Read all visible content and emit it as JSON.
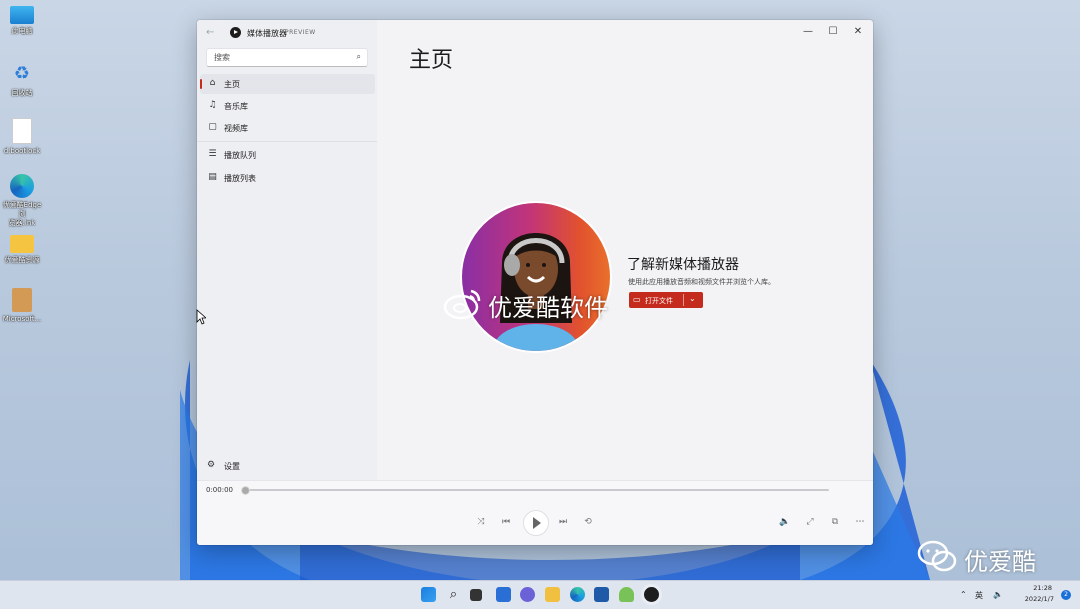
{
  "desktop": {
    "icons": [
      {
        "label": "此电脑",
        "icon": "monitor-icon"
      },
      {
        "label": "回收站",
        "icon": "recycle-bin-icon"
      },
      {
        "label": "d.bootlock",
        "icon": "document-icon"
      },
      {
        "label": "优爱酷Edge浏\n览器.lnk",
        "icon": "edge-icon"
      },
      {
        "label": "优爱酷资源",
        "icon": "folder-icon"
      },
      {
        "label": "Microsoft...",
        "icon": "package-icon"
      }
    ]
  },
  "window": {
    "app_title": "媒体播放器",
    "app_badge": "PREVIEW",
    "controls": {
      "minimize": "—",
      "maximize": "☐",
      "close": "✕"
    }
  },
  "sidebar": {
    "search_placeholder": "搜索",
    "items": [
      {
        "label": "主页",
        "icon": "home-icon",
        "active": true
      },
      {
        "label": "音乐库",
        "icon": "music-note-icon",
        "active": false
      },
      {
        "label": "视频库",
        "icon": "video-icon",
        "active": false
      },
      {
        "label": "播放队列",
        "icon": "queue-icon",
        "active": false
      },
      {
        "label": "播放列表",
        "icon": "playlist-icon",
        "active": false
      }
    ],
    "settings_label": "设置"
  },
  "main": {
    "page_title": "主页",
    "hero": {
      "title": "了解新媒体播放器",
      "subtitle": "使用此应用播放音频和视频文件并浏览个人库。",
      "open_button_label": "打开文件"
    }
  },
  "player": {
    "current_time": "0:00:00",
    "progress": 0.0
  },
  "watermarks": {
    "weibo": "优爱酷软件",
    "wechat": "优爱酷"
  },
  "taskbar": {
    "ime": "英",
    "clock_time": "21:28",
    "clock_date": "2022/1/7",
    "notifications": "2"
  },
  "colors": {
    "accent": "#c42b1c",
    "window_bg": "#f3f3f6",
    "sidebar_bg": "#eeeff3"
  }
}
